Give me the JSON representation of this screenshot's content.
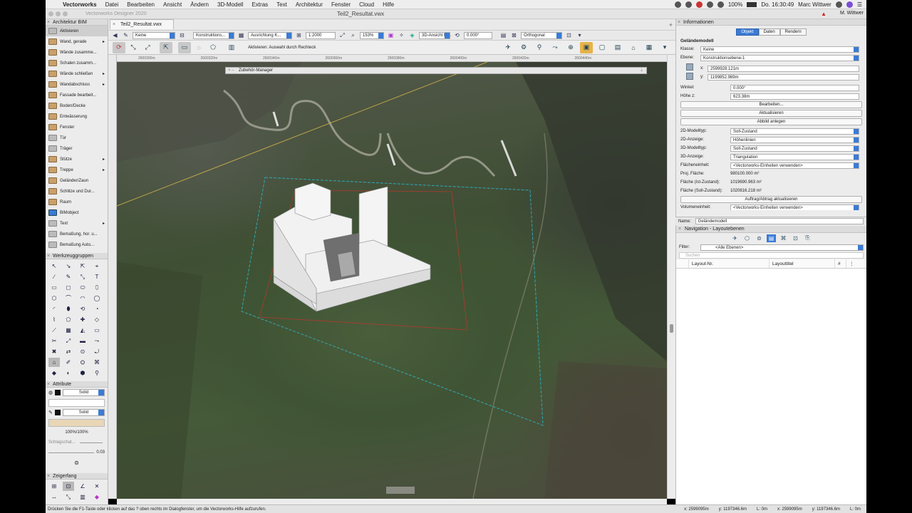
{
  "menubar": {
    "app": "Vectorworks",
    "items": [
      "Datei",
      "Bearbeiten",
      "Ansicht",
      "Ändern",
      "3D-Modell",
      "Extras",
      "Text",
      "Architektur",
      "Fenster",
      "Cloud",
      "Hilfe"
    ],
    "battery": "100%",
    "clock": "Do. 16:30:49",
    "user": "Marc Wittwer"
  },
  "window": {
    "title": "Teil2_Resultat.vwx",
    "ghost_title": "Vectorworks Designer 2020",
    "tab_label": "Teil2_Resultat.vwx",
    "user_tag": "M. Wittwer"
  },
  "toolbar": {
    "class_value": "Keine",
    "layer_value": "Konstruktions...",
    "align_value": "Ausrichtung K...",
    "scale_value": "1:2000",
    "zoom_value": "153%",
    "view3d_value": "3D-Ansicht fe...",
    "angle_value": "0.000°",
    "projection_value": "Orthogonal"
  },
  "modebar": {
    "hint": "Aktivieren: Auswahl durch Rechteck"
  },
  "ruler_labels": [
    "2600300m",
    "2600320m",
    "2600340m",
    "2600360m",
    "2600380m",
    "2600400m",
    "2600420m",
    "2600440m"
  ],
  "floating_palette": {
    "title": "Zubehör-Manager"
  },
  "architektur_palette": {
    "title": "Architektur BIM",
    "tools": [
      {
        "label": "Aktivieren",
        "icon": "arrow-select-icon",
        "submenu": false
      },
      {
        "label": "Wand, gerade",
        "icon": "wall-icon",
        "submenu": true
      },
      {
        "label": "Wände zusamme...",
        "icon": "wall-join-icon",
        "submenu": false
      },
      {
        "label": "Schalen zusamm...",
        "icon": "shell-join-icon",
        "submenu": false
      },
      {
        "label": "Wände schließen",
        "icon": "wall-close-icon",
        "submenu": true
      },
      {
        "label": "Wandabschluss",
        "icon": "wall-end-icon",
        "submenu": true
      },
      {
        "label": "Fassade bearbeit...",
        "icon": "facade-icon",
        "submenu": false
      },
      {
        "label": "Boden/Decke",
        "icon": "slab-icon",
        "submenu": false
      },
      {
        "label": "Entwässerung",
        "icon": "drainage-icon",
        "submenu": false
      },
      {
        "label": "Fenster",
        "icon": "window-icon",
        "submenu": false
      },
      {
        "label": "Tür",
        "icon": "door-icon",
        "submenu": false
      },
      {
        "label": "Träger",
        "icon": "beam-icon",
        "submenu": false
      },
      {
        "label": "Stütze",
        "icon": "column-icon",
        "submenu": true
      },
      {
        "label": "Treppe",
        "icon": "stair-icon",
        "submenu": true
      },
      {
        "label": "Geländer/Zaun",
        "icon": "railing-icon",
        "submenu": false
      },
      {
        "label": "Schlitze und Dur...",
        "icon": "slot-icon",
        "submenu": false
      },
      {
        "label": "Raum",
        "icon": "space-icon",
        "submenu": false
      },
      {
        "label": "BIMobject",
        "icon": "bimobject-icon",
        "submenu": false
      },
      {
        "label": "Text",
        "icon": "text-icon",
        "submenu": true
      },
      {
        "label": "Bemaßung, hor. u...",
        "icon": "dimension-icon",
        "submenu": false
      },
      {
        "label": "Bemaßung Auto...",
        "icon": "auto-dimension-icon",
        "submenu": false
      }
    ]
  },
  "werkzeuggruppen": {
    "title": "Werkzeuggruppen",
    "glyphs": [
      "↖",
      "↘",
      "⇱",
      "⌖",
      "∕",
      "✎",
      "⤡",
      "T",
      "▭",
      "◻",
      "⬭",
      "⬯",
      "⬡",
      "⌒",
      "◠",
      "◯",
      "◜",
      "⬮",
      "⟲",
      "◔",
      "⌇",
      "⬠",
      "✚",
      "◇",
      "⟋",
      "▦",
      "◭",
      "▭",
      "✂",
      "⤢",
      "▬",
      "⤳",
      "✖",
      "⇄",
      "⊙",
      "⤾",
      "⌂",
      "✐",
      "⛭",
      "⌘",
      "◆",
      "◐",
      "⬢",
      "⚲"
    ]
  },
  "attribute": {
    "title": "Attribute",
    "fill": "Solid",
    "pen": "Solid",
    "opacity": "100%/100%",
    "shadow_label": "Schlagschat...",
    "line_weight": "0.03"
  },
  "zeigerfang": {
    "title": "Zeigerfang"
  },
  "info": {
    "title": "Informationen",
    "tabs": [
      "Objekt",
      "Daten",
      "Rendern"
    ],
    "object_type": "Geländemodell",
    "klasse_label": "Klasse:",
    "klasse_value": "Keine",
    "ebene_label": "Ebene:",
    "ebene_value": "Konstruktionsebene-1",
    "x_label": "x:",
    "x_value": "2599928.121m",
    "y_label": "y:",
    "y_value": "1199852.989m",
    "winkel_label": "Winkel:",
    "winkel_value": "0.000°",
    "hoehe_label": "Höhe z:",
    "hoehe_value": "623.38m",
    "btn_edit": "Bearbeiten...",
    "btn_update": "Aktualisieren",
    "btn_snapshot": "Abbild anlegen",
    "rows": [
      {
        "label": "2D-Modelltyp:",
        "value": "Soll-Zustand"
      },
      {
        "label": "2D-Anzeige:",
        "value": "Höhenlinien"
      },
      {
        "label": "3D-Modelltyp:",
        "value": "Soll-Zustand"
      },
      {
        "label": "3D-Anzeige:",
        "value": "Triangulation"
      },
      {
        "label": "Flächeneinheit:",
        "value": "<Vectorworks-Einheiten verwenden>"
      }
    ],
    "proj_flaeche_label": "Proj. Fläche:",
    "proj_flaeche_value": "980100.000 m²",
    "flaeche_ist_label": "Fläche (Ist-Zustand):",
    "flaeche_ist_value": "1019690.963 m²",
    "flaeche_soll_label": "Fläche (Soll-Zustand):",
    "flaeche_soll_value": "1020816.218 m²",
    "btn_cutfill": "Auftrag/Abtrag aktualisieren",
    "volumen_label": "Volumeneinheit:",
    "volumen_value": "<Vectorworks-Einheiten verwenden>",
    "name_label": "Name:",
    "name_value": "Geländemodell"
  },
  "navigation": {
    "title": "Navigation - Layoutebenen",
    "filter_label": "Filter:",
    "filter_value": "<Alle Ebenen>",
    "search_placeholder": "Suchen",
    "col_nr": "Layout-Nr.",
    "col_title": "Layouttitel",
    "col_hash": "#"
  },
  "status": {
    "hint": "Drücken Sie die F1-Taste oder klicken auf das ? oben rechts im Dialogfenster, um die Vectorworks-Hilfe aufzurufen.",
    "x1": "x: 2599095m",
    "y1": "y: 1197346.6m",
    "l1": "L: 0m",
    "x2": "x: 2599095m",
    "y2": "y: 1197346.6m",
    "l2": "L: 0m"
  },
  "colors": {
    "accent": "#3a7bd5",
    "selection_outline": "#2fa8b8",
    "grade_outline": "#b03a2e",
    "building": "#f2f2f2"
  }
}
